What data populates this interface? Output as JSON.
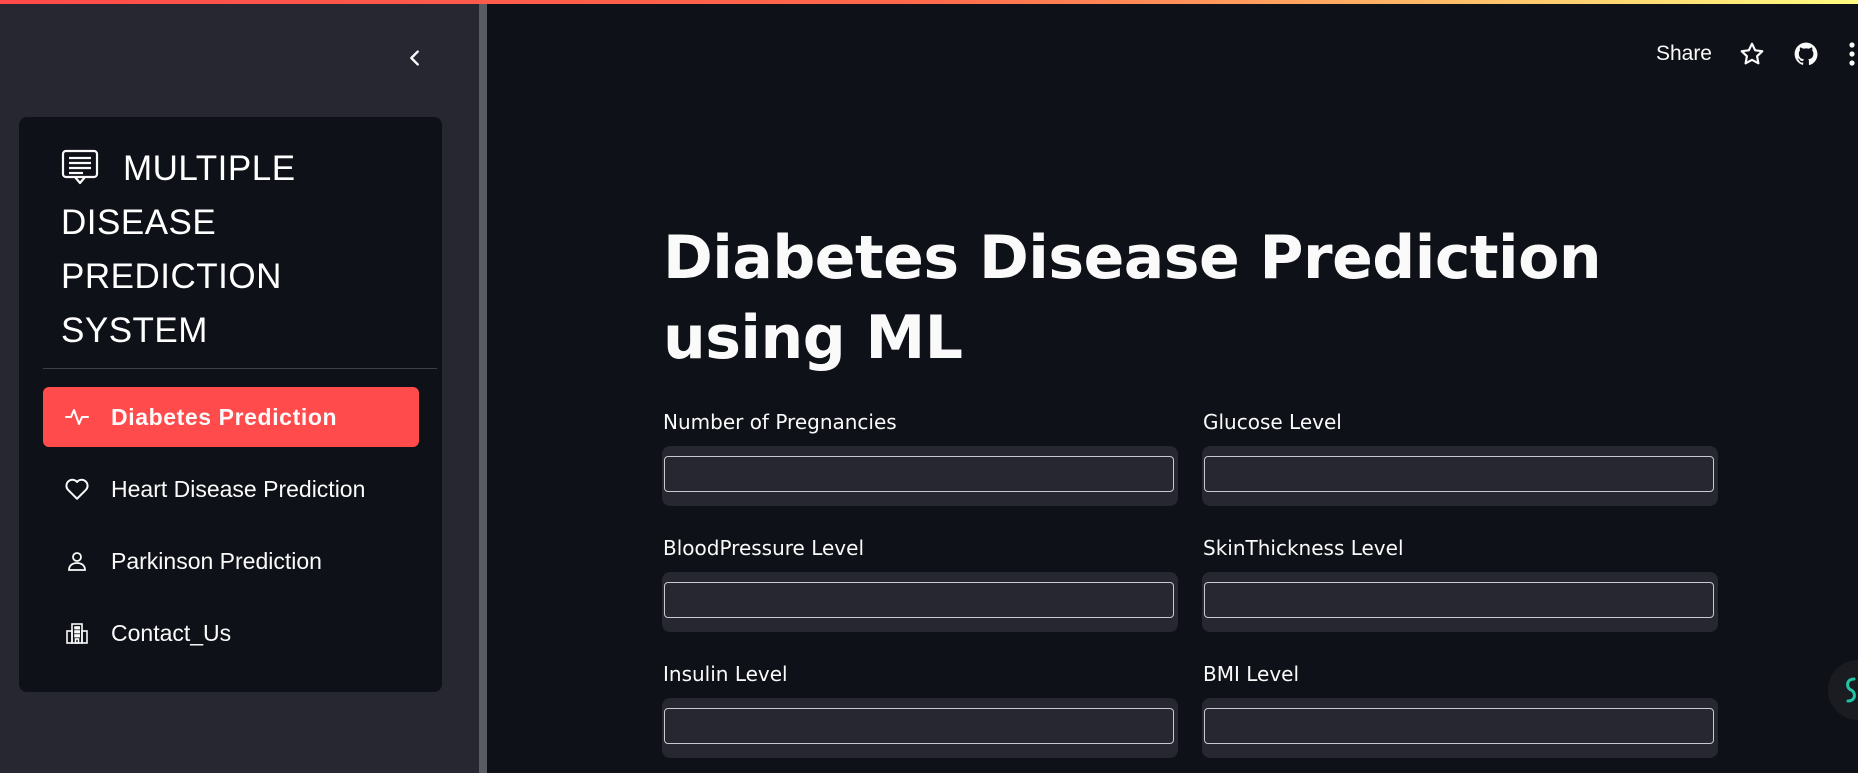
{
  "sidebar": {
    "app_title": "MULTIPLE DISEASE PREDICTION SYSTEM",
    "items": [
      {
        "label": "Diabetes Prediction",
        "icon": "activity-icon",
        "active": true
      },
      {
        "label": "Heart Disease Prediction",
        "icon": "heart-icon",
        "active": false
      },
      {
        "label": "Parkinson Prediction",
        "icon": "person-icon",
        "active": false
      },
      {
        "label": "Contact_Us",
        "icon": "building-icon",
        "active": false
      }
    ]
  },
  "header": {
    "share_label": "Share",
    "icons": [
      "star-icon",
      "github-icon",
      "more-vertical-icon"
    ]
  },
  "main": {
    "title": "Diabetes Disease Prediction using ML",
    "fields": [
      {
        "label": "Number of Pregnancies",
        "value": ""
      },
      {
        "label": "Glucose Level",
        "value": ""
      },
      {
        "label": "BloodPressure Level",
        "value": ""
      },
      {
        "label": "SkinThickness Level",
        "value": ""
      },
      {
        "label": "Insulin Level",
        "value": ""
      },
      {
        "label": "BMI Level",
        "value": ""
      }
    ]
  },
  "colors": {
    "accent": "#ff4b4b",
    "background": "#0e1117",
    "sidebar": "#262730",
    "text": "#fafafa"
  }
}
